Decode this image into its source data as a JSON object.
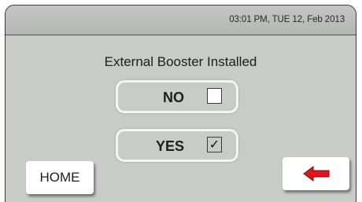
{
  "status_bar": {
    "datetime": "03:01 PM, TUE 12, Feb 2013"
  },
  "main": {
    "heading": "External Booster Installed",
    "options": [
      {
        "label": "NO",
        "checked": false,
        "mark": ""
      },
      {
        "label": "YES",
        "checked": true,
        "mark": "✓"
      }
    ]
  },
  "nav": {
    "home_label": "HOME",
    "back_icon": "left-arrow-icon",
    "back_icon_color": "#e0161b"
  },
  "colors": {
    "panel_bg": "#c9cbc9",
    "button_bg": "#ffffff",
    "option_border": "#f5f5f5"
  }
}
